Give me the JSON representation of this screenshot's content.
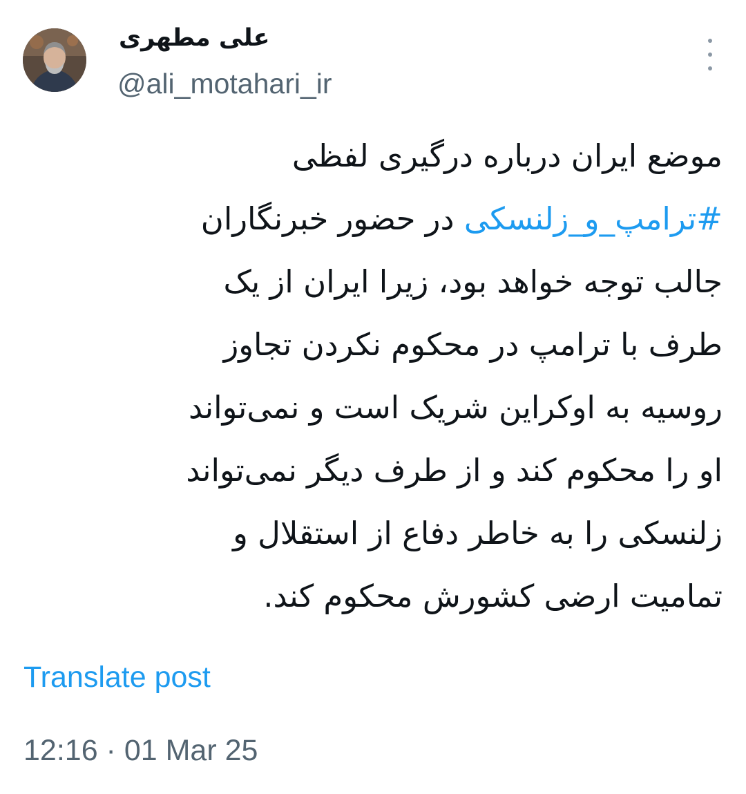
{
  "author": {
    "display_name": "علی مطهری",
    "handle": "@ali_motahari_ir",
    "avatar_icon": "user-avatar-photo"
  },
  "menu": {
    "icon": "more-vertical-icon"
  },
  "tweet": {
    "line1": "موضع ایران درباره درگیری لفظی",
    "hashtag": "#ترامپ_و_زلنسکی",
    "line2_rest": "در حضور خبرنگاران",
    "line3": "جالب توجه خواهد بود، زیرا ایران از یک",
    "line4": "طرف با ترامپ در محکوم نکردن تجاوز",
    "line5": "روسیه به اوکراین شریک است و نمی‌تواند",
    "line6": "او را محکوم کند و از طرف دیگر نمی‌تواند",
    "line7": "زلنسکی را به خاطر دفاع از استقلال و",
    "line8": "تمامیت ارضی کشورش محکوم کند."
  },
  "translate_label": "Translate post",
  "timestamp": "12:16 · 01 Mar 25",
  "colors": {
    "link": "#1d9bf0",
    "secondary_text": "#536471",
    "primary_text": "#0f1419"
  }
}
